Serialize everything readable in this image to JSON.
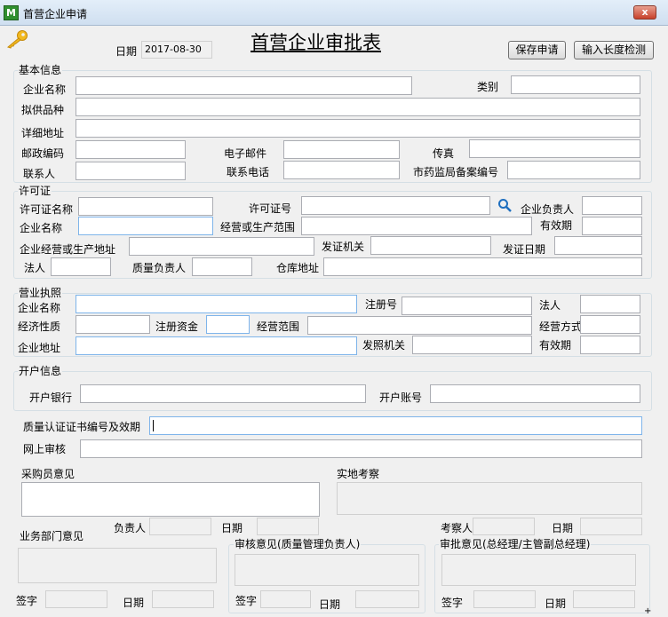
{
  "window": {
    "title": "首营企业申请",
    "app_icon_text": "M",
    "close_label": "x",
    "close_color": "#c7412b"
  },
  "header": {
    "title": "首营企业审批表",
    "date_label": "日期",
    "date_value": "2017-08-30",
    "save_button": "保存申请",
    "check_button": "输入长度检测"
  },
  "basic": {
    "section": "基本信息",
    "company_name": "企业名称",
    "category": "类别",
    "products": "拟供品种",
    "address": "详细地址",
    "postcode": "邮政编码",
    "email": "电子邮件",
    "fax": "传真",
    "contact": "联系人",
    "phone": "联系电话",
    "record_no": "市药监局备案编号"
  },
  "license": {
    "section": "许可证",
    "name": "许可证名称",
    "number": "许可证号",
    "manager": "企业负责人",
    "company": "企业名称",
    "scope": "经营或生产范围",
    "validity": "有效期",
    "address": "企业经营或生产地址",
    "authority": "发证机关",
    "issue_date": "发证日期",
    "legal": "法人",
    "quality": "质量负责人",
    "warehouse": "仓库地址"
  },
  "business": {
    "section": "营业执照",
    "company": "企业名称",
    "reg_no": "注册号",
    "legal": "法人",
    "nature": "经济性质",
    "capital": "注册资金",
    "scope": "经营范围",
    "mode": "经营方式",
    "address": "企业地址",
    "authority": "发照机关",
    "validity": "有效期"
  },
  "bank": {
    "section": "开户信息",
    "bank": "开户银行",
    "account": "开户账号"
  },
  "quality_cert": "质量认证证书编号及效期",
  "online_review": "网上审核",
  "opinions": {
    "buyer": "采购员意见",
    "site": "实地考察",
    "responsible": "负责人",
    "date": "日期",
    "inspector": "考察人",
    "dept": "业务部门意见",
    "audit": "审核意见(质量管理负责人)",
    "approval": "审批意见(总经理/主管副总经理)",
    "sign": "签字"
  },
  "icons": {
    "key": "key-icon",
    "search": "search-icon",
    "grip": "+"
  }
}
